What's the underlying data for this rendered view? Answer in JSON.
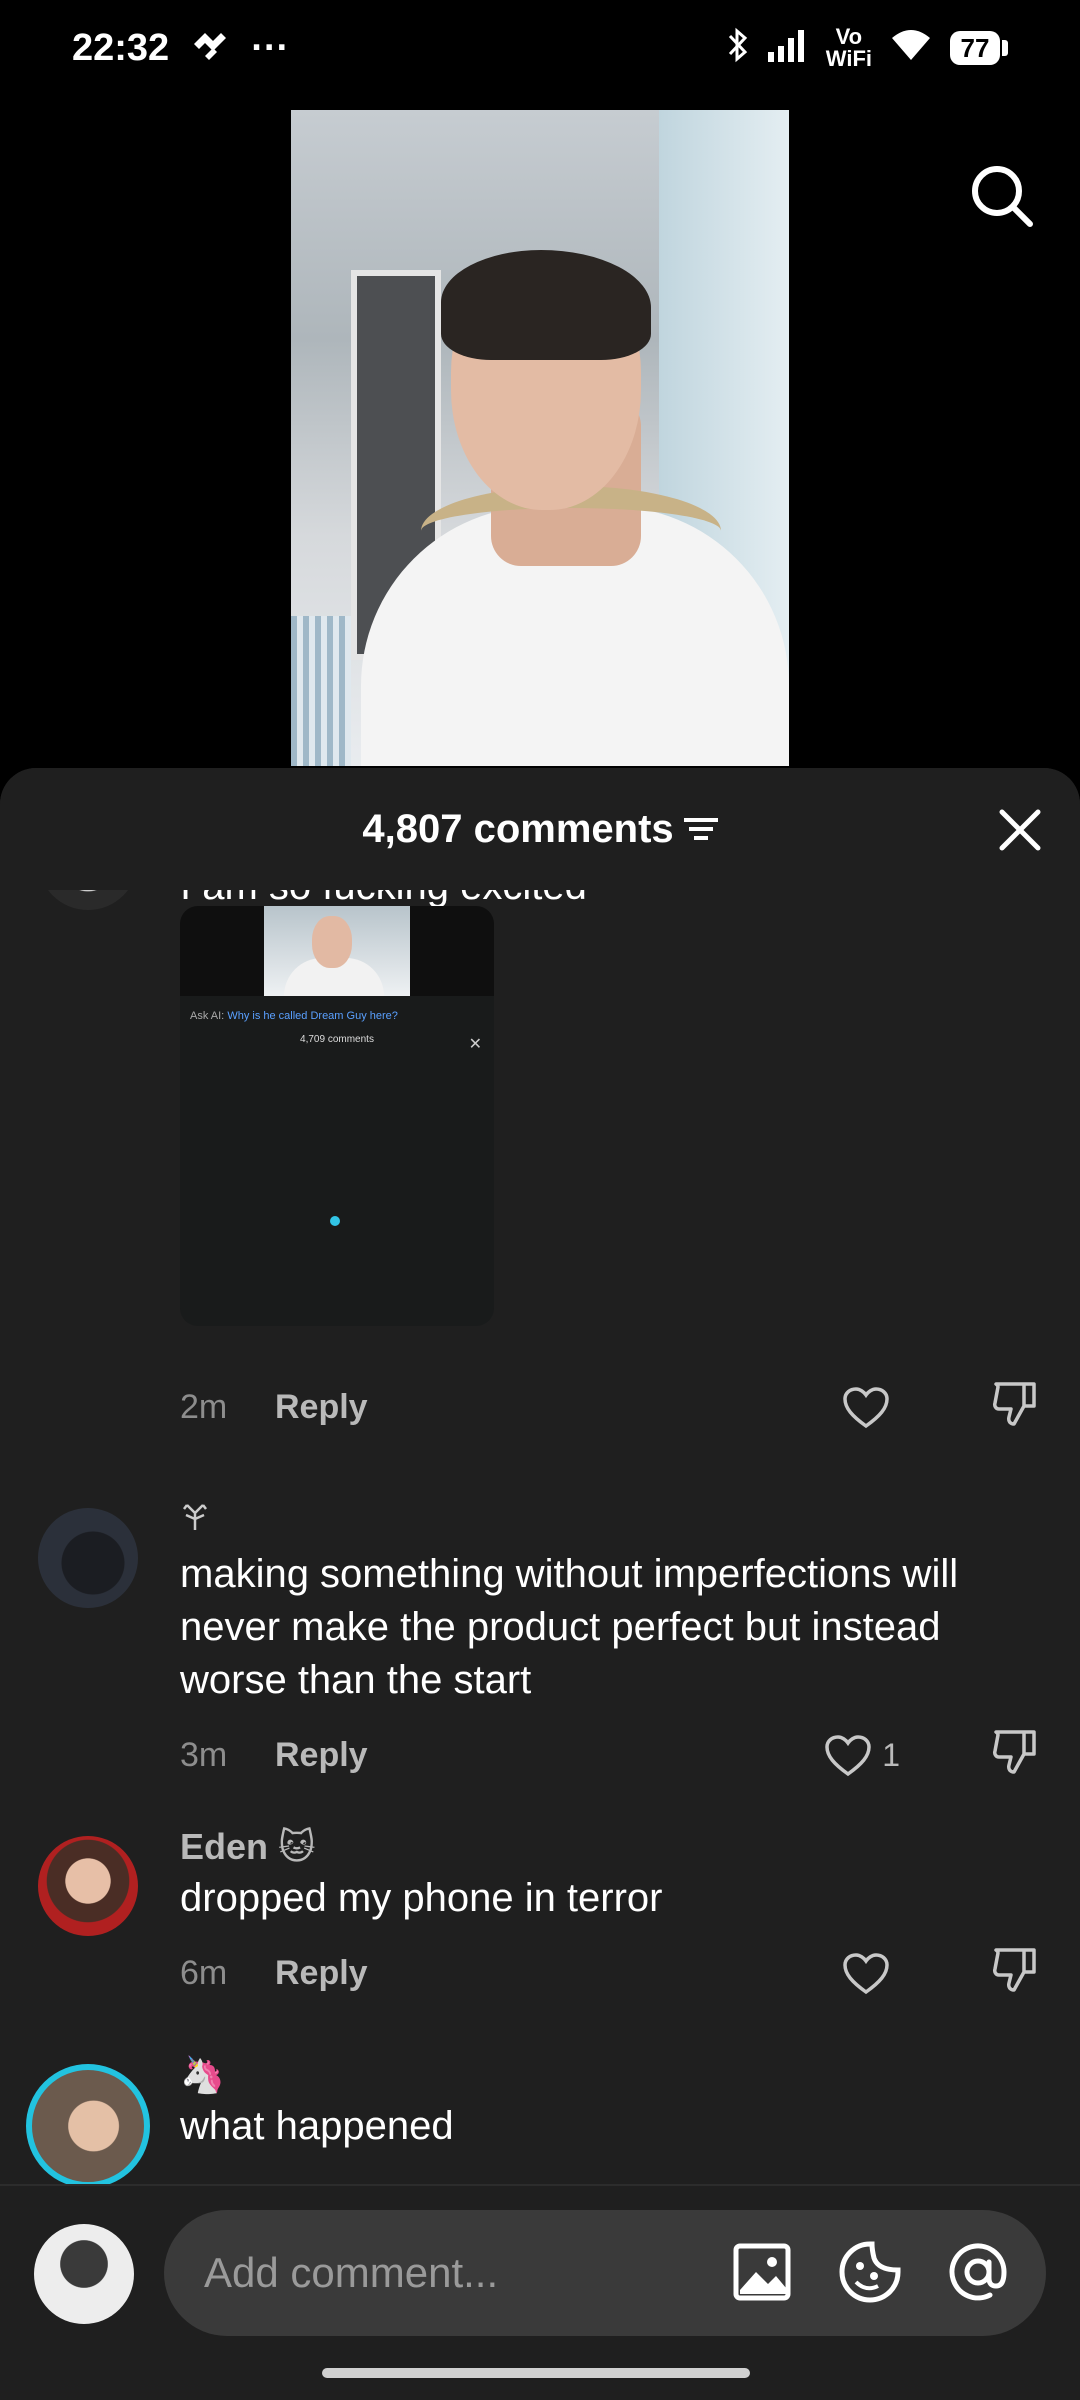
{
  "status_bar": {
    "time": "22:32",
    "dots": "···",
    "network_label_top": "Vo",
    "network_label_bottom": "WiFi",
    "battery": "77"
  },
  "video": {
    "description_icon": "person-video"
  },
  "comments_sheet": {
    "count_title": "4,807 comments",
    "comments": [
      {
        "text": "I am so fucking excited",
        "time": "2m",
        "reply_label": "Reply",
        "likes": "",
        "attachment": {
          "ask_prefix": "Ask AI:",
          "ask_question": "Why is he called Dream Guy here?",
          "mini_title": "4,709 comments"
        }
      },
      {
        "username_icon": "tree-symbol",
        "text": "making something without imperfections will never make the product perfect but instead worse than the start",
        "time": "3m",
        "reply_label": "Reply",
        "likes": "1"
      },
      {
        "username": "Eden",
        "username_emoji": "🐱",
        "text": "dropped my phone in terror",
        "time": "6m",
        "reply_label": "Reply",
        "likes": ""
      },
      {
        "username_emoji": "🦄",
        "text": "what happened"
      }
    ]
  },
  "input_bar": {
    "placeholder": "Add comment..."
  }
}
